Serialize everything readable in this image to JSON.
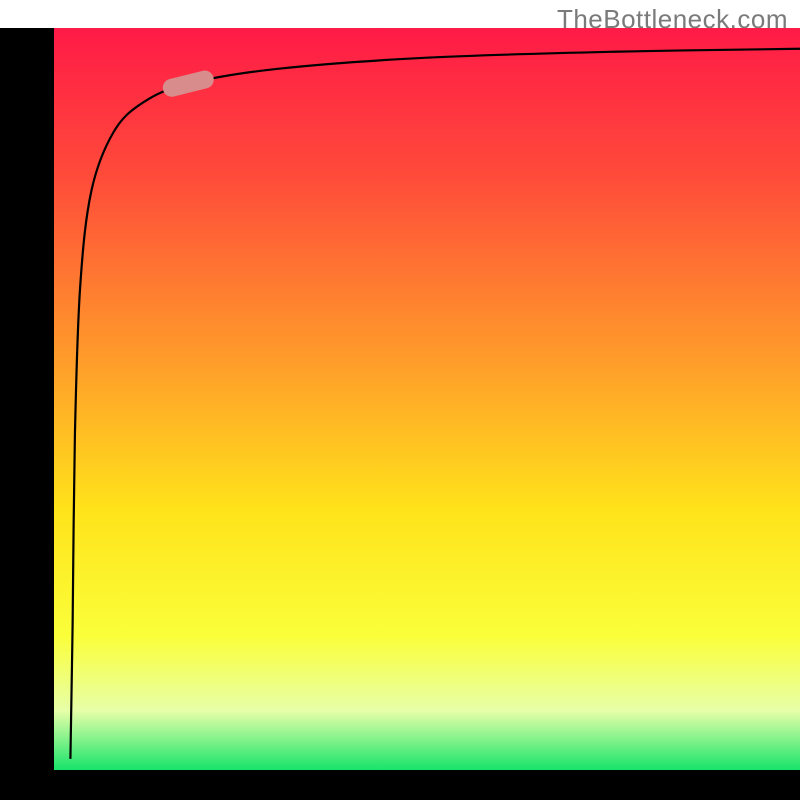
{
  "attribution": "TheBottleneck.com",
  "chart_data": {
    "type": "area",
    "title": "",
    "xlabel": "",
    "ylabel": "",
    "xlim": [
      0,
      100
    ],
    "ylim": [
      0,
      100
    ],
    "gradient_stops": [
      {
        "offset": 0.0,
        "color": "#ff1a47"
      },
      {
        "offset": 0.2,
        "color": "#ff4b3a"
      },
      {
        "offset": 0.45,
        "color": "#ff9d2a"
      },
      {
        "offset": 0.65,
        "color": "#ffe31a"
      },
      {
        "offset": 0.82,
        "color": "#faff3a"
      },
      {
        "offset": 0.92,
        "color": "#e7ffa8"
      },
      {
        "offset": 1.0,
        "color": "#17e46b"
      }
    ],
    "curve": [
      {
        "x": 2.2,
        "y": 1.5
      },
      {
        "x": 2.5,
        "y": 20
      },
      {
        "x": 2.8,
        "y": 45
      },
      {
        "x": 3.5,
        "y": 65
      },
      {
        "x": 5.0,
        "y": 78
      },
      {
        "x": 8.0,
        "y": 86
      },
      {
        "x": 12.0,
        "y": 90
      },
      {
        "x": 18.0,
        "y": 92.5
      },
      {
        "x": 30.0,
        "y": 94.5
      },
      {
        "x": 50.0,
        "y": 96.0
      },
      {
        "x": 75.0,
        "y": 96.8
      },
      {
        "x": 100.0,
        "y": 97.2
      }
    ],
    "marker": {
      "x": 18.0,
      "y": 92.5,
      "color": "#d88c8c"
    },
    "notes": "Logarithmic-style saturation curve over full-range vertical color gradient (red→green). Axes unlabeled; values estimated as percentage of plot area."
  }
}
